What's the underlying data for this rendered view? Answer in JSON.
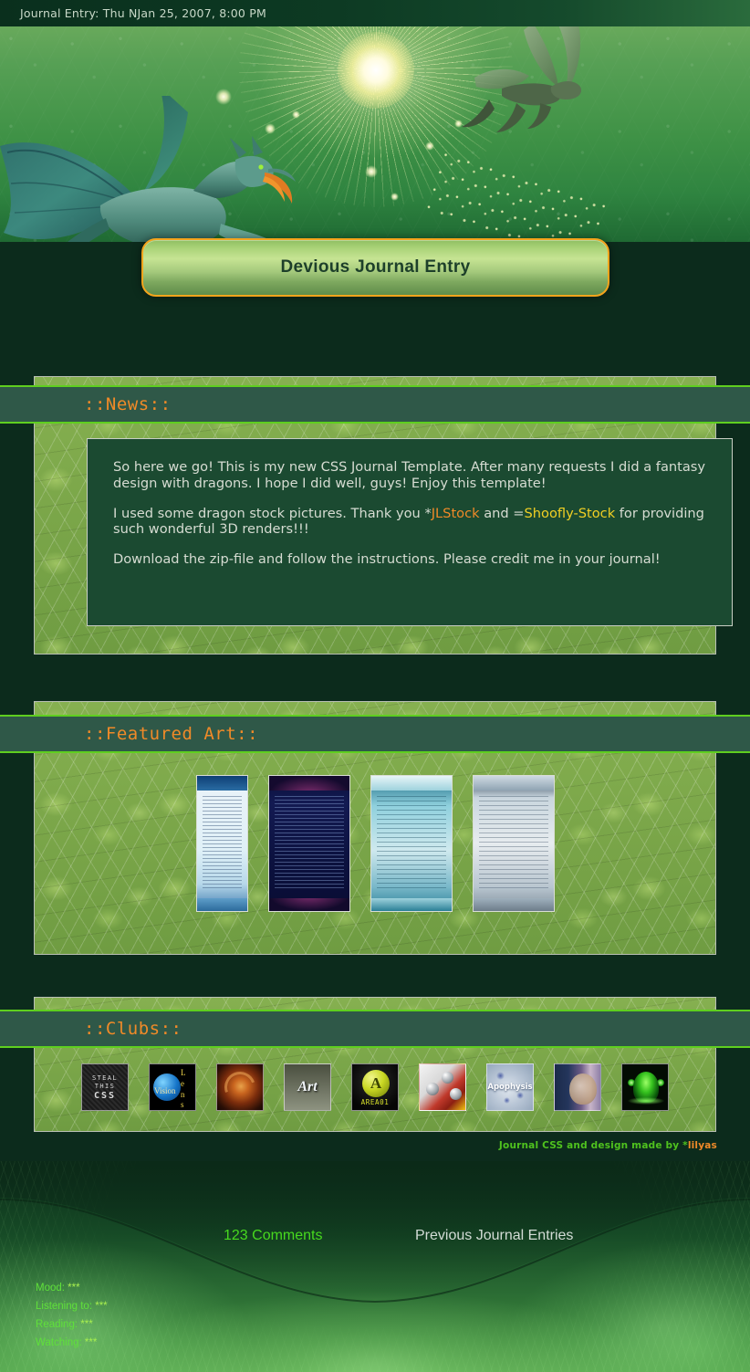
{
  "window": {
    "title_bar": "Journal Entry: Thu NJan 25, 2007, 8:00 PM"
  },
  "header": {
    "plaque_title": "Devious Journal Entry"
  },
  "colors": {
    "accent_orange": "#f08a28",
    "accent_yellow": "#f2d024",
    "bright_green": "#5fcf1f",
    "header_bar": "#2f5848",
    "panel_green": "#7fa94a",
    "content_box": "#1b4a31",
    "plaque_border": "#f4a41c",
    "comments_green": "#47d91e",
    "credit_green": "#4fc21e",
    "page_bg": "#0c2b1c"
  },
  "sections": {
    "news": {
      "heading": "::News::",
      "paragraphs": [
        {
          "parts": [
            {
              "text": "So here we go! This is my new CSS Journal Template. After many requests I did a fantasy design with dragons. I hope I did well, guys! Enjoy this template!",
              "style": "normal"
            }
          ]
        },
        {
          "parts": [
            {
              "text": "I used some dragon stock pictures. Thank you *",
              "style": "normal"
            },
            {
              "text": "JLStock",
              "style": "orange"
            },
            {
              "text": " and =",
              "style": "normal"
            },
            {
              "text": "Shoofly-Stock",
              "style": "yellow"
            },
            {
              "text": " for providing such wonderful 3D renders!!!",
              "style": "normal"
            }
          ]
        },
        {
          "parts": [
            {
              "text": "Download the zip-file and follow the instructions. Please credit me in your journal!",
              "style": "normal"
            }
          ]
        }
      ],
      "p1": "So here we go! This is my new CSS Journal Template. After many requests I did a fantasy design with dragons. I hope I did well, guys! Enjoy this template!",
      "p2_pre": "I used some dragon stock pictures. Thank you *",
      "p2_link1": "JLStock",
      "p2_mid": " and =",
      "p2_link2": "Shoofly-Stock",
      "p2_post": " for providing such wonderful 3D renders!!!",
      "p3": "Download the zip-file and follow the instructions. Please credit me in your journal!"
    },
    "featured_art": {
      "heading": "::Featured Art::",
      "thumbnails": [
        {
          "name": "light-blue-journal-css-preview"
        },
        {
          "name": "dark-blue-spider-journal-css-preview"
        },
        {
          "name": "teal-autumn-journal-css-preview"
        },
        {
          "name": "silver-future-journal-css-preview"
        }
      ]
    },
    "clubs": {
      "heading": "::Clubs::",
      "icons": [
        {
          "name": "steal-this-css-icon",
          "line1": "STEAL",
          "line2": "THIS",
          "line3": "CSS"
        },
        {
          "name": "lens-vision-icon",
          "label": "Vision",
          "letters": [
            "L",
            "e",
            "n",
            "s"
          ]
        },
        {
          "name": "fractal-spiral-icon"
        },
        {
          "name": "art-icon",
          "label": "Art"
        },
        {
          "name": "area01-icon",
          "letter": "A",
          "label": "AREA01"
        },
        {
          "name": "chrome-abstract-icon"
        },
        {
          "name": "apophysis-icon",
          "label": "Apophysis"
        },
        {
          "name": "portrait-photo-icon"
        },
        {
          "name": "green-meditation-icon"
        }
      ]
    }
  },
  "credit": {
    "prefix": "Journal CSS and design made by *",
    "author": "lilyas"
  },
  "footer": {
    "comments": "123 Comments",
    "previous": "Previous Journal Entries",
    "meta": [
      {
        "label": "Mood:",
        "value": "***"
      },
      {
        "label": "Listening to:",
        "value": "***"
      },
      {
        "label": "Reading:",
        "value": "***"
      },
      {
        "label": "Watching:",
        "value": "***"
      }
    ]
  }
}
